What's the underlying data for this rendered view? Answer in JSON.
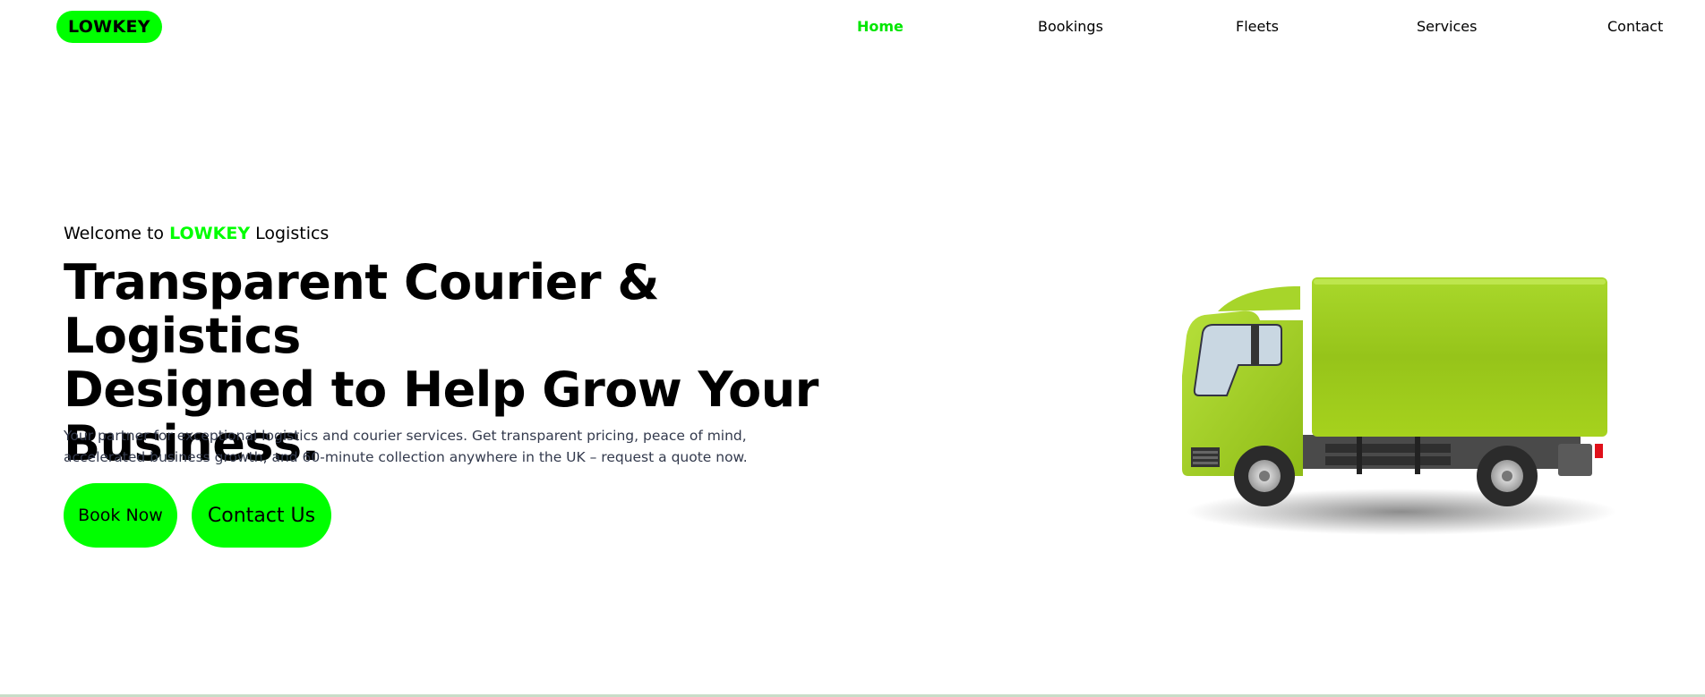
{
  "header": {
    "logo": "LOWKEY",
    "nav": [
      {
        "label": "Home",
        "active": true
      },
      {
        "label": "Bookings",
        "active": false
      },
      {
        "label": "Fleets",
        "active": false
      },
      {
        "label": "Services",
        "active": false
      },
      {
        "label": "Contact",
        "active": false
      }
    ]
  },
  "hero": {
    "welcome_prefix": "Welcome to",
    "welcome_brand": "LOWKEY",
    "welcome_suffix": "Logistics",
    "headline_line1": "Transparent Courier & Logistics",
    "headline_line2": "Designed to Help Grow Your",
    "headline_line3": "Business.",
    "description": "Your partner for exceptional logistics and courier services. Get transparent pricing, peace of mind, accelerated business growth, and 60-minute collection anywhere in the UK – request a quote now.",
    "book_button": "Book Now",
    "contact_button": "Contact Us"
  },
  "colors": {
    "accent": "#00ff00",
    "truck_body": "#9ccd1a",
    "text_muted": "#333a4d"
  },
  "icons": {
    "hero_image": "green-delivery-truck"
  }
}
